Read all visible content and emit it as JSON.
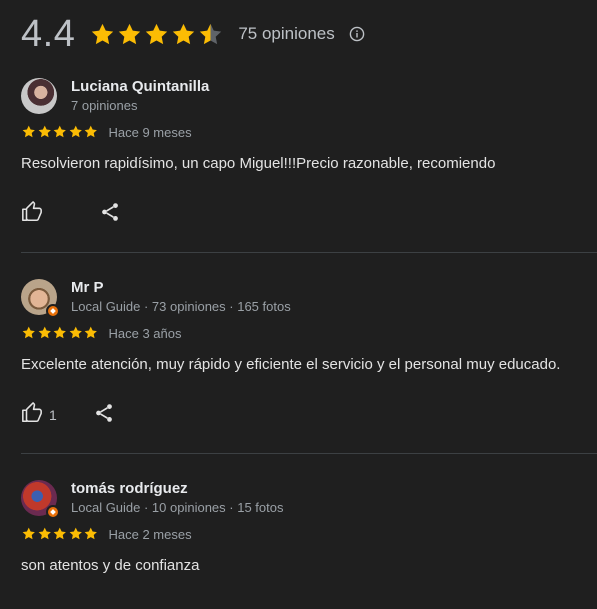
{
  "summary": {
    "rating": "4.4",
    "rating_value": 4.4,
    "stars_shown": 4.5,
    "count_label": "75 opiniones",
    "info_icon": "info-circle-icon"
  },
  "colors": {
    "background": "#1f1f1f",
    "star": "#fbbc04",
    "star_empty": "#5f6368",
    "divider": "#3c4043",
    "local_guide_badge": "#e8710a"
  },
  "reviews": [
    {
      "name": "Luciana Quintanilla",
      "sub": "7 opiniones",
      "stars": 5,
      "date": "Hace 9 meses",
      "text": "Resolvieron rapidísimo, un capo Miguel!!!Precio razonable, recomiendo",
      "likes": "",
      "local_guide": false
    },
    {
      "name": "Mr P",
      "sub": "Local Guide · 73 opiniones · 165 fotos",
      "stars": 5,
      "date": "Hace 3 años",
      "text": "Excelente atención, muy rápido y eficiente el servicio y el personal muy educado.",
      "likes": "1",
      "local_guide": true
    },
    {
      "name": "tomás rodríguez",
      "sub": "Local Guide · 10 opiniones · 15 fotos",
      "stars": 5,
      "date": "Hace 2 meses",
      "text": "son atentos y de confianza",
      "likes": "",
      "local_guide": true
    }
  ],
  "icons": {
    "like": "thumbs-up-icon",
    "share": "share-icon",
    "star": "star-icon"
  }
}
